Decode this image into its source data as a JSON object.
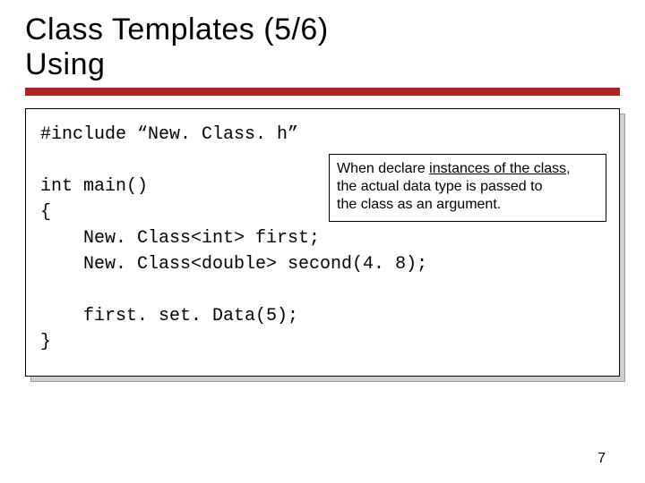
{
  "title_line1": "Class Templates (5/6)",
  "title_line2": "Using",
  "code": {
    "l1": "#include “New. Class. h”",
    "l2": "",
    "l3": "int main()",
    "l4": "{",
    "l5": "    New. Class<int> first;",
    "l6": "    New. Class<double> second(4. 8);",
    "l7": "",
    "l8": "    first. set. Data(5);",
    "l9": "}"
  },
  "callout": {
    "phrase1_pre": "When declare ",
    "phrase1_u": "instances of the class",
    "phrase1_post": ",",
    "phrase2": "the actual data type is passed to",
    "phrase3": "the class as an argument."
  },
  "page_number": "7"
}
